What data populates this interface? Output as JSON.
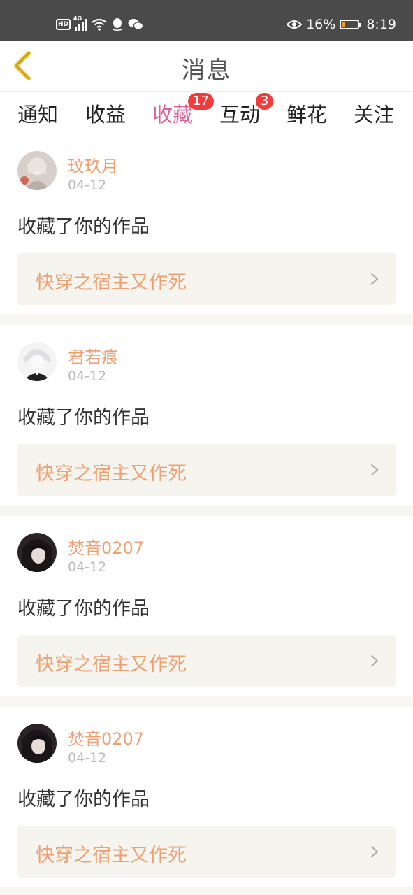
{
  "status_bar": {
    "hd": "HD",
    "network": "4G",
    "battery": "16%",
    "time": "8:19",
    "battery_level": 0.16
  },
  "header": {
    "title": "消息"
  },
  "tabs": [
    {
      "label": "通知"
    },
    {
      "label": "收益"
    },
    {
      "label": "收藏",
      "badge": "17",
      "active": true
    },
    {
      "label": "互动",
      "badge": "3"
    },
    {
      "label": "鲜花"
    },
    {
      "label": "关注"
    }
  ],
  "items": [
    {
      "user": "玟玖月",
      "date": "04-12",
      "action": "收藏了你的作品",
      "work": "快穿之宿主又作死"
    },
    {
      "user": "君若痕",
      "date": "04-12",
      "action": "收藏了你的作品",
      "work": "快穿之宿主又作死"
    },
    {
      "user": "焚音0207",
      "date": "04-12",
      "action": "收藏了你的作品",
      "work": "快穿之宿主又作死"
    },
    {
      "user": "焚音0207",
      "date": "04-12",
      "action": "收藏了你的作品",
      "work": "快穿之宿主又作死"
    }
  ],
  "colors": {
    "accent_pink": "#e0609a",
    "accent_orange": "#f0a070",
    "badge_red": "#f13c3c",
    "back_yellow": "#e8c030"
  },
  "icons": [
    "back-chevron-icon",
    "wifi-icon",
    "qq-icon",
    "wechat-icon",
    "eye-icon",
    "battery-icon",
    "chevron-right-icon"
  ]
}
